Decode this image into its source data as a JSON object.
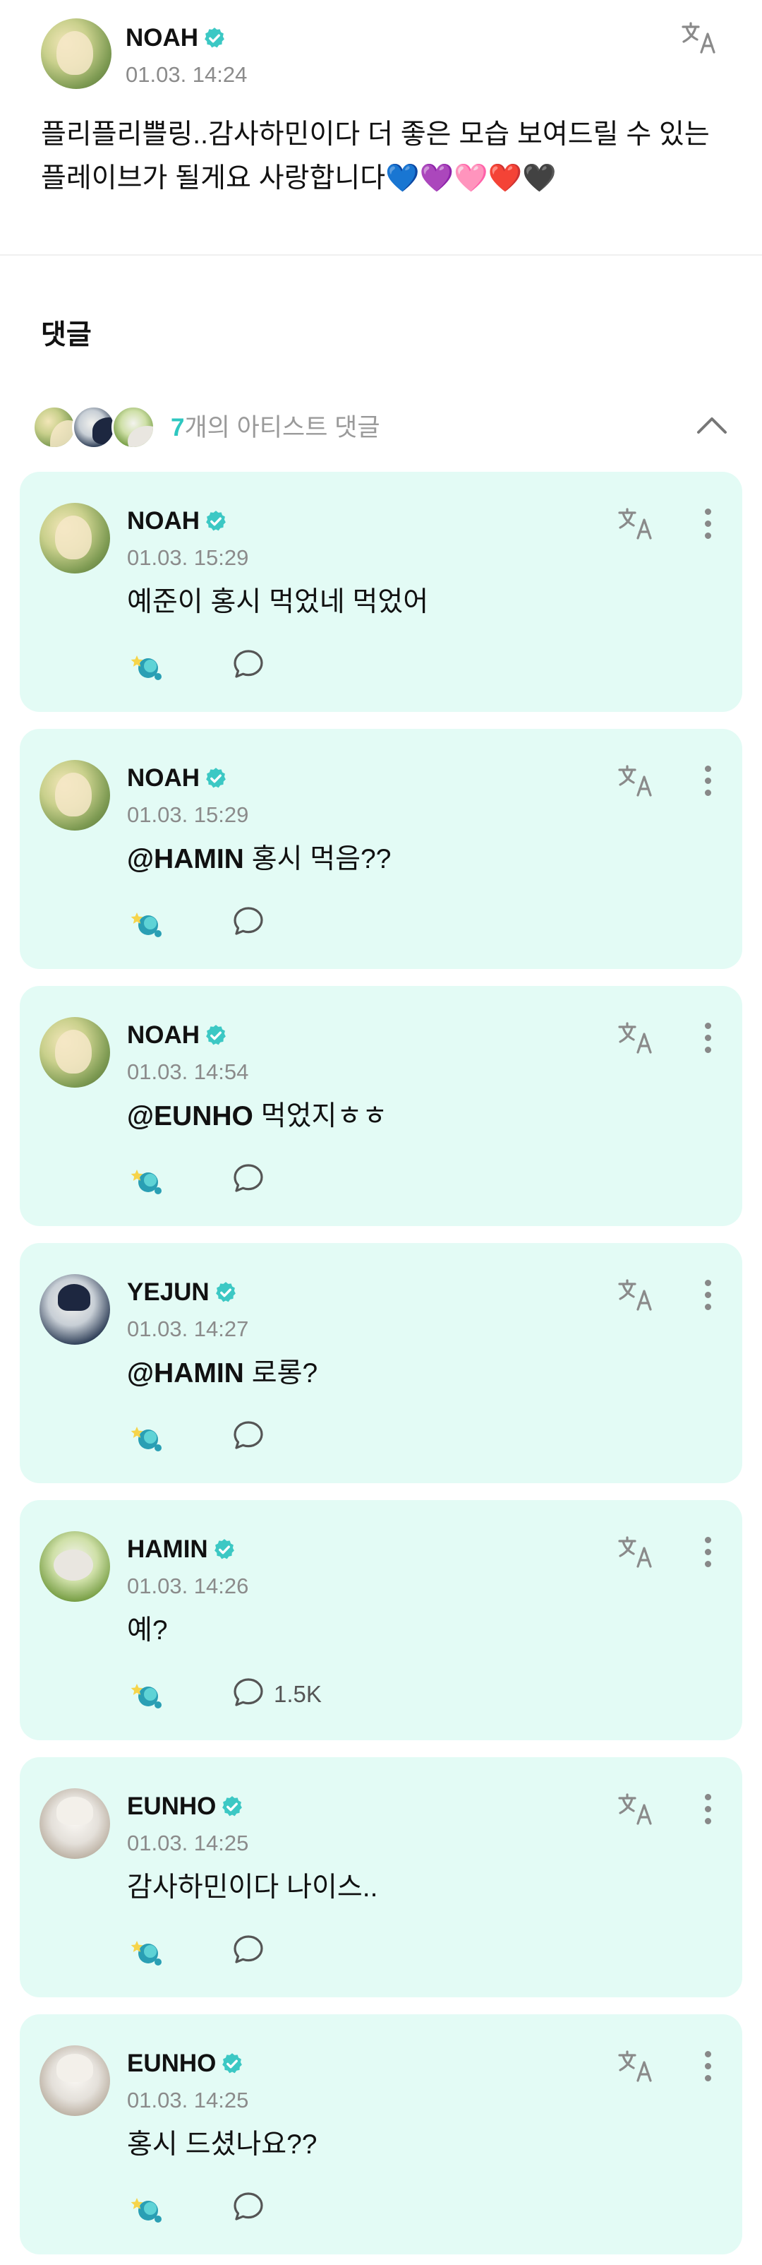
{
  "post": {
    "author": "NOAH",
    "timestamp": "01.03. 14:24",
    "body": "플리플리쁠링..감사하민이다 더 좋은 모습 보여드릴 수 있는 플레이브가 될게요 사랑합니다💙💜🩷❤️🖤"
  },
  "comments_section": {
    "title": "댓글",
    "artist_count_number": "7",
    "artist_count_suffix": "개의 아티스트 댓글"
  },
  "comments": [
    {
      "author": "NOAH",
      "timestamp": "01.03. 15:29",
      "mention": "",
      "text": "예준이 홍시 먹었네 먹었어",
      "replies": ""
    },
    {
      "author": "NOAH",
      "timestamp": "01.03. 15:29",
      "mention": "@HAMIN",
      "text": " 홍시 먹음??",
      "replies": ""
    },
    {
      "author": "NOAH",
      "timestamp": "01.03. 14:54",
      "mention": "@EUNHO",
      "text": " 먹었지ㅎㅎ",
      "replies": ""
    },
    {
      "author": "YEJUN",
      "timestamp": "01.03. 14:27",
      "mention": "@HAMIN",
      "text": " 로롱?",
      "replies": ""
    },
    {
      "author": "HAMIN",
      "timestamp": "01.03. 14:26",
      "mention": "",
      "text": "예?",
      "replies": "1.5K"
    },
    {
      "author": "EUNHO",
      "timestamp": "01.03. 14:25",
      "mention": "",
      "text": "감사하민이다 나이스..",
      "replies": ""
    },
    {
      "author": "EUNHO",
      "timestamp": "01.03. 14:25",
      "mention": "",
      "text": "홍시 드셨나요??",
      "replies": ""
    }
  ],
  "icons": {
    "verified": "verified-badge-icon",
    "translate": "translate-icon",
    "more": "more-vertical-icon",
    "collapse": "chevron-up-icon",
    "reaction": "reaction-icon",
    "reply": "reply-bubble-icon"
  },
  "colors": {
    "accent": "#2ec7c0",
    "card_background": "#e3fbf5",
    "timestamp": "#8b8b8b"
  }
}
